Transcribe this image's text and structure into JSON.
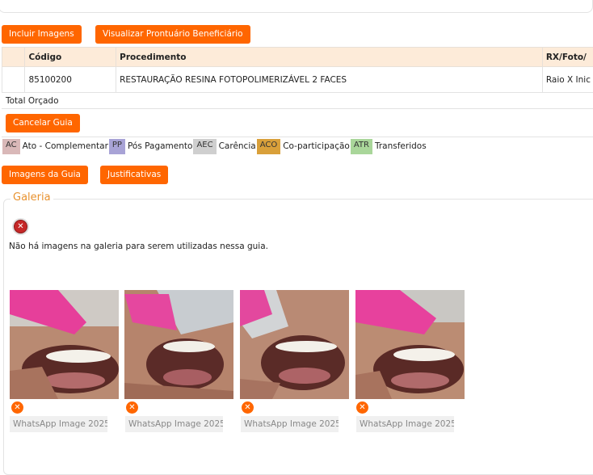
{
  "actions": {
    "include_images": "Incluir Imagens",
    "view_record": "Visualizar Prontuário Beneficiário",
    "cancel_guide": "Cancelar Guia",
    "guide_images": "Imagens da Guia",
    "justifications": "Justificativas"
  },
  "table": {
    "headers": [
      "Código",
      "Procedimento",
      "RX/Foto/"
    ],
    "rows": [
      {
        "code": "85100200",
        "procedure": "RESTAURAÇÃO RESINA FOTOPOLIMERIZÁVEL 2 FACES",
        "rx": "Raio X Inic"
      }
    ],
    "total_label": "Total Orçado"
  },
  "legend": [
    {
      "code": "AC",
      "label": "Ato - Complementar",
      "color": "#d9b8b8"
    },
    {
      "code": "PP",
      "label": "Pós Pagamento",
      "color": "#a8a3d6"
    },
    {
      "code": "AEC",
      "label": "Carência",
      "color": "#cfcfcf"
    },
    {
      "code": "ACO",
      "label": "Co-participação",
      "color": "#d9a03a"
    },
    {
      "code": "ATR",
      "label": "Transferidos",
      "color": "#a9d69a"
    }
  ],
  "gallery": {
    "title": "Galeria",
    "empty_message": "Não há imagens na galeria para serem utilizadas nessa guia.",
    "images": [
      {
        "name": "WhatsApp Image 2025"
      },
      {
        "name": "WhatsApp Image 2025"
      },
      {
        "name": "WhatsApp Image 2025"
      },
      {
        "name": "WhatsApp Image 2025"
      }
    ]
  }
}
